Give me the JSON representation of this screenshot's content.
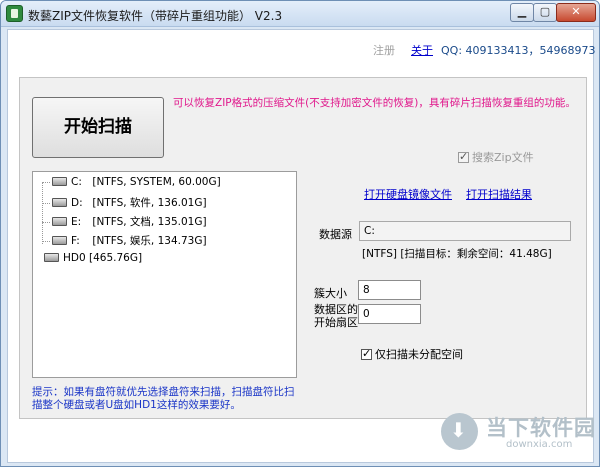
{
  "window": {
    "title": "数藝ZIP文件恢复软件（带碎片重组功能） V2.3",
    "controls": {
      "minimize": "▁",
      "maximize": "▢",
      "close": "✕"
    }
  },
  "header": {
    "register": "注册",
    "about": "关于",
    "qq": "QQ: 409133413，54968973"
  },
  "main": {
    "start_button": "开始扫描",
    "description": "可以恢复ZIP格式的压缩文件(不支持加密文件的恢复)，具有碎片扫描恢复重组的功能。",
    "search_zip": {
      "label": "搜索Zip文件",
      "checked": true,
      "enabled": false
    },
    "drives": [
      {
        "letter": "C:",
        "info": "[NTFS, SYSTEM, 60.00G]"
      },
      {
        "letter": "D:",
        "info": "[NTFS, 软件, 136.01G]"
      },
      {
        "letter": "E:",
        "info": "[NTFS, 文档, 135.01G]"
      },
      {
        "letter": "F:",
        "info": "[NTFS, 娱乐, 134.73G]"
      },
      {
        "letter": "HD0",
        "info": "[465.76G]"
      }
    ],
    "links": {
      "open_image": "打开硬盘镜像文件",
      "open_result": "打开扫描结果"
    },
    "data_source": {
      "label": "数据源",
      "value": "C:"
    },
    "source_info": "[NTFS]  [扫描目标：剩余空间：41.48G]",
    "cluster": {
      "label": "簇大小",
      "value": "8"
    },
    "start_sector": {
      "label_line1": "数据区的",
      "label_line2": "开始扇区",
      "value": "0"
    },
    "only_unallocated": {
      "label": "仅扫描未分配空间",
      "checked": true
    },
    "tip": "提示：如果有盘符就优先选择盘符来扫描，扫描盘符比扫描整个硬盘或者U盘如HD1这样的效果要好。"
  },
  "watermark": {
    "big": "当下软件园",
    "small": "downxia.com"
  }
}
